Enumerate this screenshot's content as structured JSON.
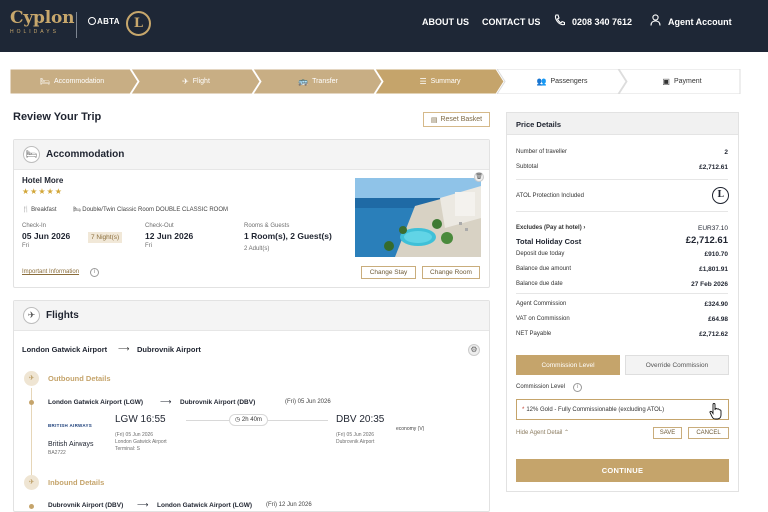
{
  "header": {
    "brand": "Cyplon",
    "brand_sub": "HOLIDAYS",
    "abta": "ABTA",
    "atol_mark": "L",
    "nav": {
      "about": "ABOUT US",
      "contact": "CONTACT US",
      "phone": "0208 340 7612",
      "account": "Agent Account"
    }
  },
  "stepper": {
    "steps": [
      {
        "label": "Accommodation",
        "icon": "bed-icon"
      },
      {
        "label": "Flight",
        "icon": "plane-icon"
      },
      {
        "label": "Transfer",
        "icon": "bus-icon"
      },
      {
        "label": "Summary",
        "icon": "summary-icon"
      },
      {
        "label": "Passengers",
        "icon": "people-icon"
      },
      {
        "label": "Payment",
        "icon": "payment-icon"
      }
    ],
    "active_index": 3,
    "colors": {
      "done": "#c8ae84",
      "active": "#c5a46b",
      "pending": "#ffffff"
    }
  },
  "main": {
    "title": "Review Your Trip",
    "reset_label": "Reset Basket"
  },
  "accommodation": {
    "title": "Accommodation",
    "hotel_name": "Hotel More",
    "stars": 5,
    "board": "Breakfast",
    "room": "Double/Twin Classic Room DOUBLE CLASSIC ROOM",
    "checkin_label": "Check-In",
    "checkin_date": "05 Jun 2026",
    "checkin_day": "Fri",
    "nights": "7 Night(s)",
    "checkout_label": "Check-Out",
    "checkout_date": "12 Jun 2026",
    "checkout_day": "Fri",
    "rooms_label": "Rooms & Guests",
    "rooms_value": "1 Room(s), 2 Guest(s)",
    "adults": "2 Adult(s)",
    "important_info": "Important Information",
    "change_stay": "Change Stay",
    "change_room": "Change Room"
  },
  "flights": {
    "title": "Flights",
    "route_from": "London Gatwick Airport",
    "route_to": "Dubrovnik Airport",
    "outbound": {
      "title": "Outbound Details",
      "from": "London Gatwick Airport (LGW)",
      "to": "Dubrovnik Airport (DBV)",
      "date": "(Fri) 05 Jun 2026",
      "airline_logo": "BRITISH AIRWAYS",
      "airline": "British Airways",
      "flight_no": "BA2722",
      "dep_time": "LGW 16:55",
      "dep_date": "(Fri) 05 Jun 2026",
      "dep_airport": "London Gatwick Airport",
      "dep_terminal": "Terminal: S",
      "duration": "2h 40m",
      "arr_time": "DBV 20:35",
      "arr_date": "(Fri) 05 Jun 2026",
      "arr_airport": "Dubrovnik Airport",
      "cabin": "economy (V)"
    },
    "inbound": {
      "title": "Inbound Details",
      "from": "Dubrovnik Airport (DBV)",
      "to": "London Gatwick Airport (LGW)",
      "date": "(Fri) 12 Jun 2026"
    }
  },
  "price": {
    "title": "Price Details",
    "travellers_label": "Number of traveller",
    "travellers": "2",
    "subtotal_label": "Subtotal",
    "subtotal": "£2,712.61",
    "atol_label": "ATOL Protection Included",
    "excludes_label": "Excludes (Pay at hotel)",
    "excludes": "EUR37.10",
    "total_label": "Total Holiday Cost",
    "total": "£2,712.61",
    "deposit_label": "Deposit due today",
    "deposit": "£910.70",
    "balance_label": "Balance due amount",
    "balance": "£1,801.91",
    "balance_date_label": "Balance due date",
    "balance_date": "27 Feb 2026",
    "agent_comm_label": "Agent Commission",
    "agent_comm": "£324.90",
    "vat_label": "VAT on Commission",
    "vat": "£64.98",
    "net_label": "NET Payable",
    "net": "£2,712.62",
    "commission_tab": "Commission Level",
    "override_tab": "Override Commission",
    "commission_level_label": "Commission Level",
    "commission_select": "12% Gold - Fully Commissionable (excluding ATOL)",
    "hide_agent": "Hide Agent Detail",
    "save": "SAVE",
    "cancel": "CANCEL",
    "continue": "CONTINUE"
  }
}
